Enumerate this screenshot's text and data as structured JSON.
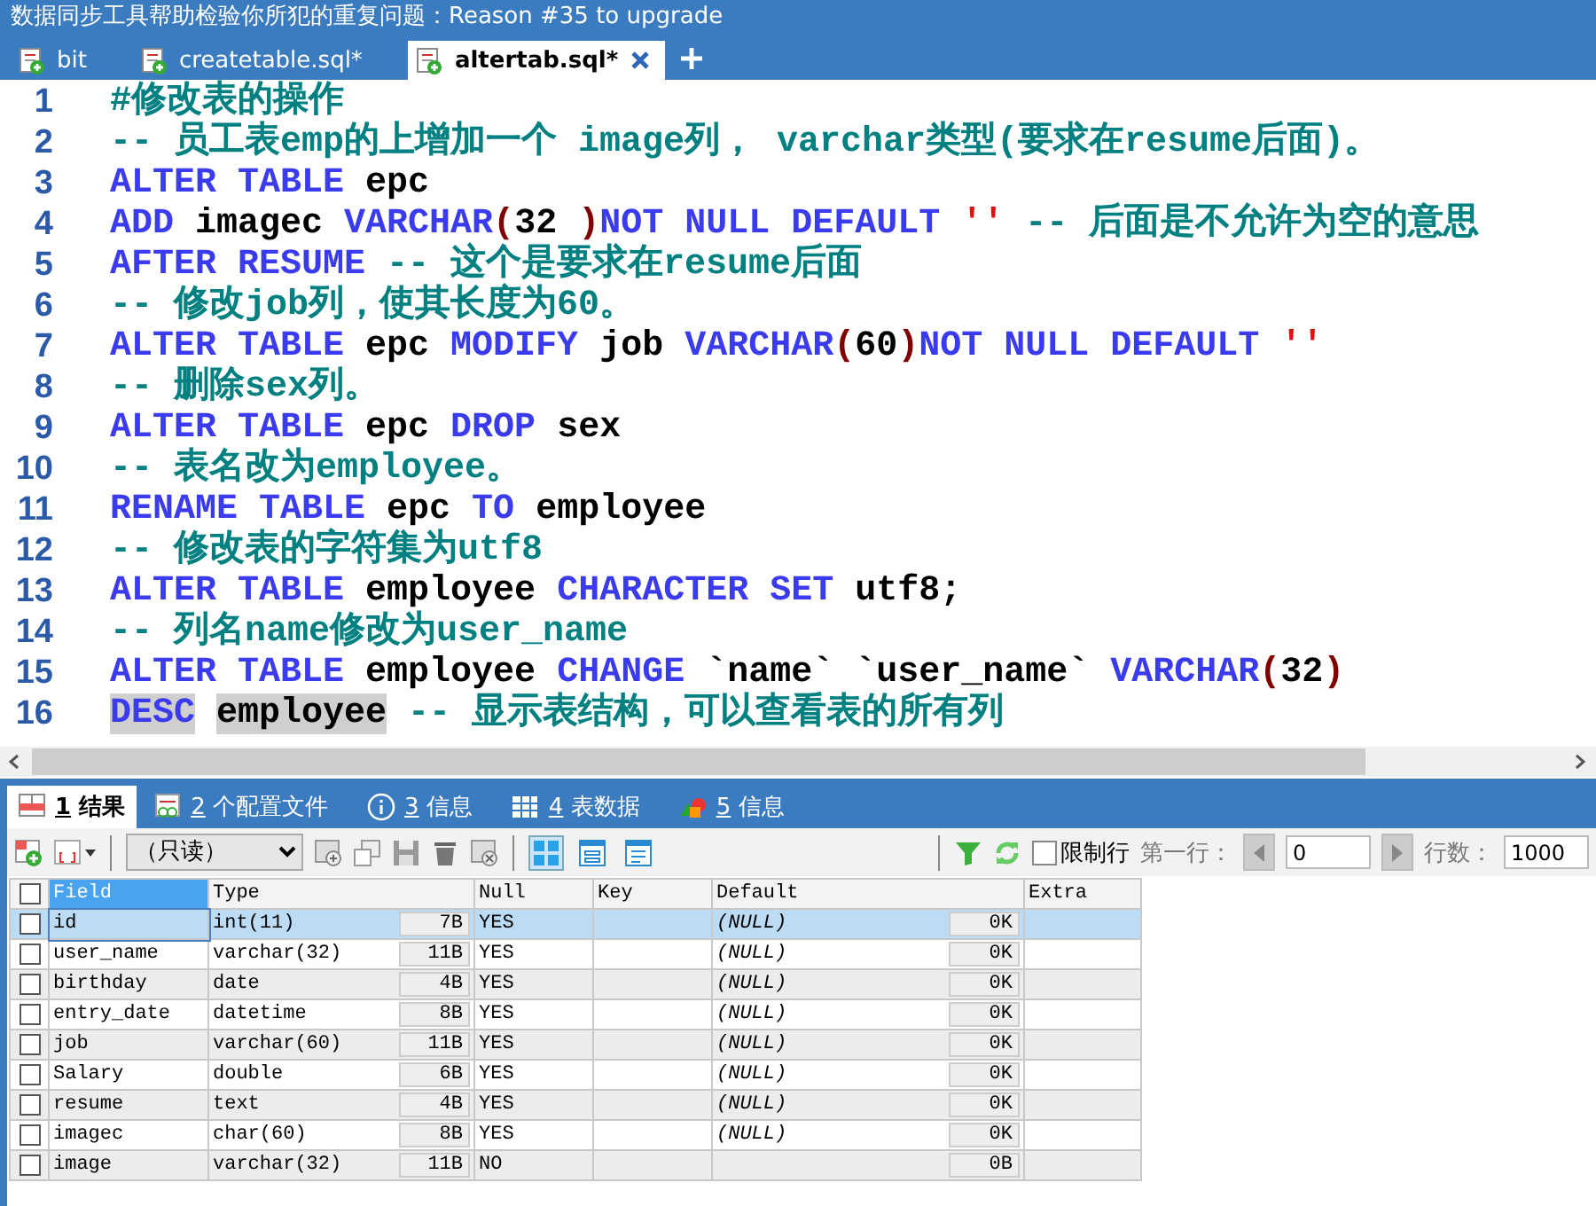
{
  "window": {
    "title": "数据同步工具帮助检验你所犯的重复问题：Reason #35 to upgrade"
  },
  "editor_tabs": [
    {
      "label": "bit",
      "selected": false,
      "closable": false
    },
    {
      "label": "createtable.sql*",
      "selected": false,
      "closable": false
    },
    {
      "label": "altertab.sql*",
      "selected": true,
      "closable": true
    }
  ],
  "editor": {
    "lines": [
      {
        "number": "1",
        "tokens": [
          {
            "kind": "cm",
            "text": "#修改表的操作"
          }
        ]
      },
      {
        "number": "2",
        "tokens": [
          {
            "kind": "cm",
            "text": "-- 员工表emp的上增加一个 image列， varchar类型(要求在resume后面)。"
          }
        ]
      },
      {
        "number": "3",
        "tokens": [
          {
            "kind": "kw",
            "text": "ALTER TABLE"
          },
          {
            "kind": "id",
            "text": " epc"
          }
        ]
      },
      {
        "number": "4",
        "tokens": [
          {
            "kind": "kw",
            "text": "ADD"
          },
          {
            "kind": "id",
            "text": " imagec "
          },
          {
            "kind": "kw",
            "text": "VARCHAR"
          },
          {
            "kind": "op",
            "text": "("
          },
          {
            "kind": "id",
            "text": "32 "
          },
          {
            "kind": "op",
            "text": ")"
          },
          {
            "kind": "kw",
            "text": "NOT NULL DEFAULT"
          },
          {
            "kind": "str",
            "text": " ''"
          },
          {
            "kind": "cm",
            "text": " -- 后面是不允许为空的意思"
          }
        ]
      },
      {
        "number": "5",
        "tokens": [
          {
            "kind": "kw",
            "text": "AFTER RESUME"
          },
          {
            "kind": "cm",
            "text": " -- 这个是要求在resume后面"
          }
        ]
      },
      {
        "number": "6",
        "tokens": [
          {
            "kind": "cm",
            "text": "-- 修改job列，使其长度为60。"
          }
        ]
      },
      {
        "number": "7",
        "tokens": [
          {
            "kind": "kw",
            "text": "ALTER TABLE"
          },
          {
            "kind": "id",
            "text": " epc "
          },
          {
            "kind": "kw",
            "text": "MODIFY"
          },
          {
            "kind": "id",
            "text": " job "
          },
          {
            "kind": "kw",
            "text": "VARCHAR"
          },
          {
            "kind": "op",
            "text": "("
          },
          {
            "kind": "id",
            "text": "60"
          },
          {
            "kind": "op",
            "text": ")"
          },
          {
            "kind": "kw",
            "text": "NOT NULL DEFAULT"
          },
          {
            "kind": "str",
            "text": " ''"
          }
        ]
      },
      {
        "number": "8",
        "tokens": [
          {
            "kind": "cm",
            "text": "-- 删除sex列。"
          }
        ]
      },
      {
        "number": "9",
        "tokens": [
          {
            "kind": "kw",
            "text": "ALTER TABLE"
          },
          {
            "kind": "id",
            "text": " epc "
          },
          {
            "kind": "kw",
            "text": "DROP"
          },
          {
            "kind": "id",
            "text": " sex"
          }
        ]
      },
      {
        "number": "10",
        "tokens": [
          {
            "kind": "cm",
            "text": "-- 表名改为employee。"
          }
        ]
      },
      {
        "number": "11",
        "tokens": [
          {
            "kind": "kw",
            "text": "RENAME TABLE"
          },
          {
            "kind": "id",
            "text": " epc "
          },
          {
            "kind": "kw",
            "text": "TO"
          },
          {
            "kind": "id",
            "text": " employee"
          }
        ]
      },
      {
        "number": "12",
        "tokens": [
          {
            "kind": "cm",
            "text": "-- 修改表的字符集为utf8"
          }
        ]
      },
      {
        "number": "13",
        "tokens": [
          {
            "kind": "kw",
            "text": "ALTER TABLE"
          },
          {
            "kind": "id",
            "text": " employee "
          },
          {
            "kind": "kw",
            "text": "CHARACTER SET"
          },
          {
            "kind": "id",
            "text": " utf8;"
          }
        ]
      },
      {
        "number": "14",
        "tokens": [
          {
            "kind": "cm",
            "text": "-- 列名name修改为user_name"
          }
        ]
      },
      {
        "number": "15",
        "tokens": [
          {
            "kind": "kw",
            "text": "ALTER TABLE"
          },
          {
            "kind": "id",
            "text": " employee "
          },
          {
            "kind": "kw",
            "text": "CHANGE"
          },
          {
            "kind": "id",
            "text": " `name` `user_name` "
          },
          {
            "kind": "kw",
            "text": "VARCHAR"
          },
          {
            "kind": "op",
            "text": "("
          },
          {
            "kind": "id",
            "text": "32"
          },
          {
            "kind": "op",
            "text": ")"
          }
        ]
      },
      {
        "number": "16",
        "tokens": [
          {
            "kind": "kw",
            "text": "DESC",
            "highlighted": true,
            "gap_after": true
          },
          {
            "kind": "id",
            "text": "employee",
            "highlighted": true
          },
          {
            "kind": "cm",
            "text": " -- 显示表结构，可以查看表的所有列"
          }
        ]
      }
    ]
  },
  "result_tabs": [
    {
      "number": "1",
      "label": "结果",
      "kind": "result",
      "selected": true
    },
    {
      "number": "2",
      "label": "个配置文件",
      "kind": "profile",
      "selected": false
    },
    {
      "number": "3",
      "label": "信息",
      "kind": "info",
      "selected": false
    },
    {
      "number": "4",
      "label": "表数据",
      "kind": "table",
      "selected": false
    },
    {
      "number": "5",
      "label": "信息",
      "kind": "shapes",
      "selected": false
    }
  ],
  "toolbar": {
    "mode_select": "（只读）",
    "view_modes": [
      {
        "selected": true
      },
      {
        "selected": false
      },
      {
        "selected": false
      }
    ],
    "limit_rows": {
      "label": "限制行",
      "checked": false
    },
    "first_row_label": "第一行：",
    "first_row_value": "0",
    "row_count_label": "行数：",
    "row_count_value": "1000"
  },
  "table": {
    "all_checked": false,
    "columns": [
      "Field",
      "Type",
      "Null",
      "Key",
      "Default",
      "Extra"
    ],
    "rows": [
      {
        "checked": false,
        "selected": true,
        "field": "id",
        "type": "int(11)",
        "type_size": "7B",
        "null": "YES",
        "default": "(NULL)",
        "default_size": "0K"
      },
      {
        "checked": false,
        "selected": false,
        "field": "user_name",
        "type": "varchar(32)",
        "type_size": "11B",
        "null": "YES",
        "default": "(NULL)",
        "default_size": "0K"
      },
      {
        "checked": false,
        "selected": false,
        "field": "birthday",
        "type": "date",
        "type_size": "4B",
        "null": "YES",
        "default": "(NULL)",
        "default_size": "0K"
      },
      {
        "checked": false,
        "selected": false,
        "field": "entry_date",
        "type": "datetime",
        "type_size": "8B",
        "null": "YES",
        "default": "(NULL)",
        "default_size": "0K"
      },
      {
        "checked": false,
        "selected": false,
        "field": "job",
        "type": "varchar(60)",
        "type_size": "11B",
        "null": "YES",
        "default": "(NULL)",
        "default_size": "0K"
      },
      {
        "checked": false,
        "selected": false,
        "field": "Salary",
        "type": "double",
        "type_size": "6B",
        "null": "YES",
        "default": "(NULL)",
        "default_size": "0K"
      },
      {
        "checked": false,
        "selected": false,
        "field": "resume",
        "type": "text",
        "type_size": "4B",
        "null": "YES",
        "default": "(NULL)",
        "default_size": "0K"
      },
      {
        "checked": false,
        "selected": false,
        "field": "imagec",
        "type": "char(60)",
        "type_size": "8B",
        "null": "YES",
        "default": "(NULL)",
        "default_size": "0K"
      },
      {
        "checked": false,
        "selected": false,
        "field": "image",
        "type": "varchar(32)",
        "type_size": "11B",
        "null": "NO",
        "default_size": "0B"
      }
    ]
  }
}
